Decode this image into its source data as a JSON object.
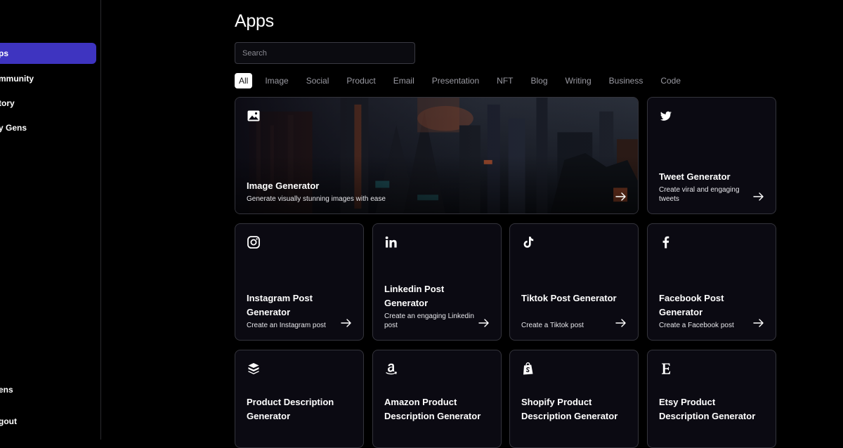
{
  "sidebar": {
    "items": [
      {
        "label": "ps"
      },
      {
        "label": "mmunity"
      },
      {
        "label": "tory"
      },
      {
        "label": "y Gens"
      }
    ],
    "bottom": [
      {
        "label": "ens"
      },
      {
        "label": "gout"
      }
    ]
  },
  "header": {
    "title": "Apps"
  },
  "search": {
    "placeholder": "Search",
    "value": ""
  },
  "tabs": [
    "All",
    "Image",
    "Social",
    "Product",
    "Email",
    "Presentation",
    "NFT",
    "Blog",
    "Writing",
    "Business",
    "Code"
  ],
  "cards": {
    "image_generator": {
      "title": "Image Generator",
      "desc": "Generate visually stunning images with ease",
      "icon": "image-icon"
    },
    "tweet": {
      "title": "Tweet Generator",
      "desc": "Create viral and engaging tweets",
      "icon": "twitter-icon"
    },
    "instagram": {
      "title": "Instagram Post Generator",
      "desc": "Create an Instagram post",
      "icon": "instagram-icon"
    },
    "linkedin": {
      "title": "Linkedin Post Generator",
      "desc": "Create an engaging Linkedin post",
      "icon": "linkedin-icon"
    },
    "tiktok": {
      "title": "Tiktok Post Generator",
      "desc": "Create a Tiktok post",
      "icon": "tiktok-icon"
    },
    "facebook": {
      "title": "Facebook Post Generator",
      "desc": "Create a Facebook post",
      "icon": "facebook-icon"
    },
    "product_desc": {
      "title": "Product Description Generator",
      "icon": "box-icon"
    },
    "amazon": {
      "title": "Amazon Product Description Generator",
      "icon": "amazon-icon"
    },
    "shopify": {
      "title": "Shopify Product Description Generator",
      "icon": "shopify-icon"
    },
    "etsy": {
      "title": "Etsy Product Description Generator",
      "icon": "etsy-icon"
    }
  },
  "colors": {
    "accent": "#3e34c0",
    "background": "#000000",
    "card": "#0b0a12",
    "border": "#34343c"
  }
}
